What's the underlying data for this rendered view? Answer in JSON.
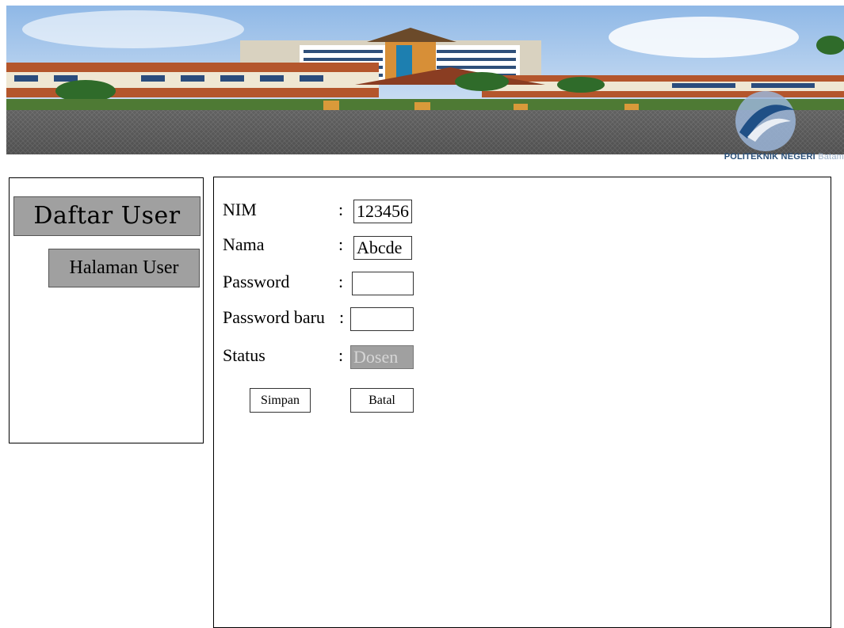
{
  "header": {
    "brand_name": "POLITEKNIK NEGERI",
    "brand_city": "Batam"
  },
  "sidebar": {
    "title": "Daftar User",
    "user_page_button": "Halaman User"
  },
  "form": {
    "fields": [
      {
        "label": "NIM",
        "value": "123456"
      },
      {
        "label": "Nama",
        "value": "Abcde"
      },
      {
        "label": "Password",
        "value": ""
      },
      {
        "label": "Password baru",
        "value": ""
      },
      {
        "label": "Status",
        "value": "Dosen"
      }
    ],
    "colon": ":",
    "save_button": "Simpan",
    "cancel_button": "Batal"
  }
}
